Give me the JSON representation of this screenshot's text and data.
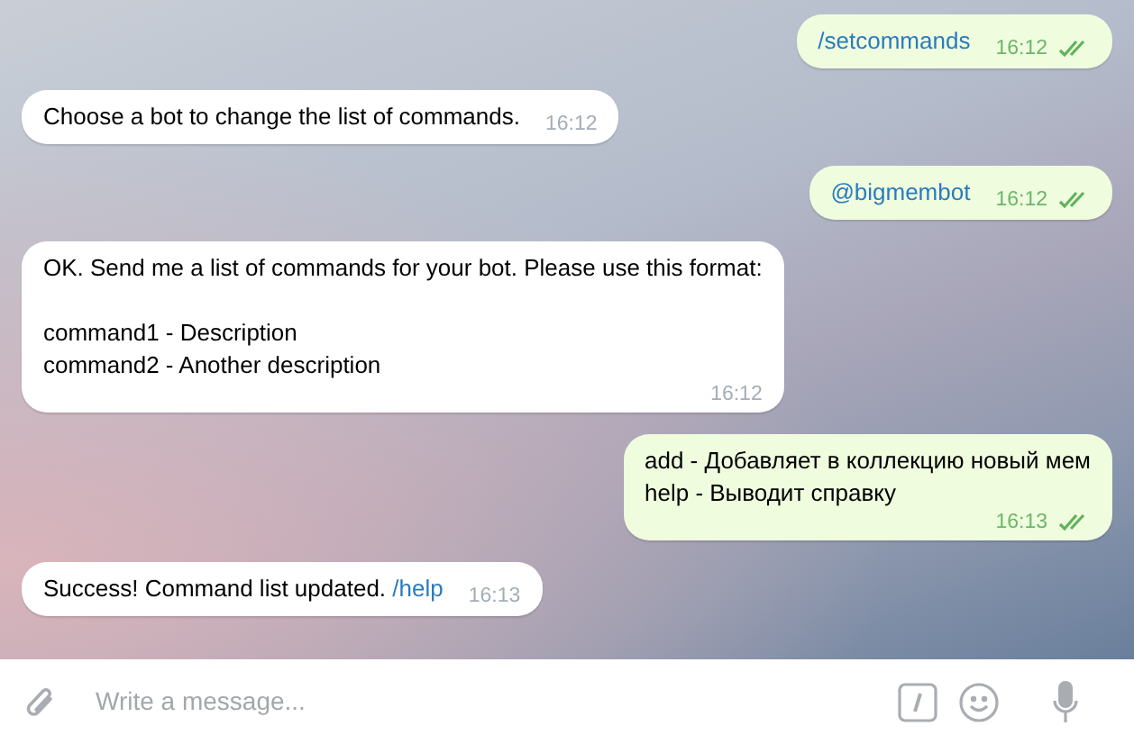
{
  "messages": [
    {
      "outgoing": true,
      "parts": [
        {
          "kind": "link",
          "text": "/setcommands"
        }
      ],
      "time": "16:12",
      "read": true
    },
    {
      "outgoing": false,
      "parts": [
        {
          "kind": "text",
          "text": "Choose a bot to change the list of commands."
        }
      ],
      "time": "16:12"
    },
    {
      "outgoing": true,
      "parts": [
        {
          "kind": "link",
          "text": "@bigmembot"
        }
      ],
      "time": "16:12",
      "read": true
    },
    {
      "outgoing": false,
      "multiline": true,
      "parts": [
        {
          "kind": "text",
          "text": "OK. Send me a list of commands for your bot. Please use this format:\n\ncommand1 - Description\ncommand2 - Another description"
        }
      ],
      "time": "16:12"
    },
    {
      "outgoing": true,
      "multiline": true,
      "parts": [
        {
          "kind": "text",
          "text": "add - Добавляет в коллекцию новый мем\nhelp - Выводит справку"
        }
      ],
      "time": "16:13",
      "read": true
    },
    {
      "outgoing": false,
      "parts": [
        {
          "kind": "text",
          "text": "Success! Command list updated. "
        },
        {
          "kind": "link",
          "text": "/help"
        }
      ],
      "time": "16:13"
    }
  ],
  "composer": {
    "placeholder": "Write a message..."
  }
}
